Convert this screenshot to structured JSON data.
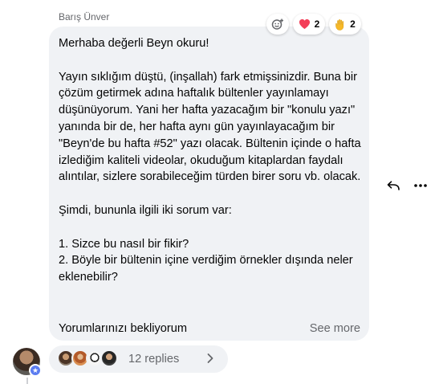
{
  "sender": {
    "name": "Barış Ünver"
  },
  "message": {
    "text": "Merhaba değerli Beyn okuru!\n\nYayın sıklığım düştü, (inşallah) fark etmişsinizdir. Buna bir çözüm getirmek adına haftalık bültenler yayınlamayı düşünüyorum. Yani her hafta yazacağım bir \"konulu yazı\" yanında bir de, her hafta aynı gün yayınlayacağım bir \"Beyn'de bu hafta #52\" yazı olacak. Bültenin içinde o hafta izlediğim kaliteli videolar, okuduğum kitaplardan faydalı alıntılar, sizlere sorabileceğim türden birer soru vb. olacak.\n\nŞimdi, bununla ilgili iki sorum var:\n\n1. Sizce bu nasıl bir fikir?\n2. Böyle bir bültenin içine verdiğim örnekler dışında neler eklenebilir?",
    "last_line": "Yorumlarınızı bekliyorum",
    "see_more": "See more"
  },
  "reactions": [
    {
      "icon": "add-reaction-icon",
      "count": null
    },
    {
      "icon": "heart-icon",
      "count": "2",
      "color": "#f33e58"
    },
    {
      "icon": "raised-hand-icon",
      "count": "2",
      "color": "#f7b928"
    }
  ],
  "actions": [
    {
      "icon": "reply-arrow-icon"
    },
    {
      "icon": "more-options-icon"
    }
  ],
  "replies": {
    "label": "12 replies",
    "avatar_count": 4
  },
  "colors": {
    "bubble_bg": "#f0f2f5",
    "secondary_text": "#65676b",
    "badge": "#5b7cf0"
  }
}
